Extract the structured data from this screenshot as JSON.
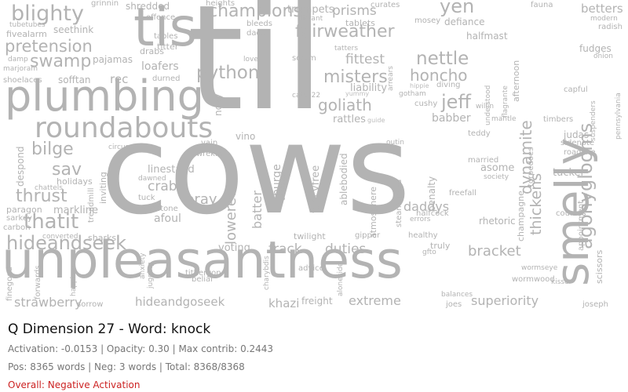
{
  "panel": {
    "title": "Q Dimension 27 - Word: knock",
    "stats_line": "Activation: -0.0153 | Opacity: 0.30 | Max contrib: 0.2443",
    "counts_line": "Pos: 8365 words | Neg: 3 words | Total: 8368/8368",
    "overall": "Overall: Negative Activation"
  },
  "colors": {
    "word_color": "#b3b3b3",
    "title_color": "#111111",
    "stat_color": "#777777",
    "overall_color": "#cc2222"
  },
  "words": [
    "til",
    "cows",
    "unpleasantness",
    "plumbing",
    "tis",
    "smelly",
    "roundabouts",
    "agonyglooms",
    "hideandseek",
    "thatit",
    "blighty",
    "champions",
    "fairweather",
    "pretension",
    "swamp",
    "misters",
    "goliath",
    "python",
    "fittest",
    "nettle",
    "honcho",
    "jeff",
    "dynamite",
    "thickens",
    "bilge",
    "sav",
    "thrust",
    "crabs",
    "bray",
    "lowered",
    "batter",
    "frack",
    "duties",
    "bracket",
    "strawberry",
    "hideandgoseek",
    "extreme",
    "superiority",
    "khazi",
    "freight",
    "daddys",
    "rec",
    "loafers",
    "prisms",
    "yen",
    "trumpets",
    "tablets",
    "betters",
    "halfmast",
    "defiance",
    "fudges",
    "voting",
    "markline",
    "linestand",
    "brimstone",
    "afoul",
    "liability",
    "rattles",
    "babber",
    "judas",
    "roadline",
    "asome",
    "tucker",
    "penalty",
    "fancyfree",
    "ablebodied",
    "atmosphere",
    "steamspeed",
    "rhetoric",
    "courses",
    "appointment",
    "scissors",
    "sarkey",
    "pajamas",
    "seethink",
    "fivealarm",
    "tubetubes",
    "drabs",
    "titter",
    "tables",
    "shredded",
    "grinnin",
    "heights",
    "offence",
    "dads",
    "bleeds",
    "scram",
    "lover",
    "catch22",
    "tatters",
    "curates",
    "distant",
    "arrears",
    "gotham",
    "cushy",
    "willin",
    "teddy",
    "outin",
    "married",
    "society",
    "freefall",
    "halfcock",
    "errors",
    "healthy",
    "gipper",
    "truly",
    "twilight",
    "advice",
    "aloneside",
    "jugging",
    "anxiety",
    "sorrow",
    "joes",
    "joseph",
    "balances",
    "wormwood",
    "kisser",
    "wormseye",
    "sidenote",
    "timbers",
    "mantle",
    "understood",
    "afternoon",
    "radish",
    "modern",
    "onion",
    "capful",
    "suspenders",
    "pennsylvania",
    "champagne",
    "torpedoes",
    "paragon",
    "holidays",
    "chattels",
    "despond",
    "finegood",
    "forwards",
    "happiness",
    "carbon",
    "converted",
    "sharks",
    "inviting",
    "treadmill",
    "circuses",
    "durned",
    "dawned",
    "tuck",
    "vino",
    "vain",
    "wrekin",
    "sofftan",
    "shoelaces",
    "marjoram",
    "damp",
    "nosy",
    "purge",
    "terrors",
    "belial",
    "titheryon",
    "charybdis",
    "gfto",
    "flagrante",
    "fauna",
    "hippie",
    "yummy",
    "diving",
    "guide",
    "mosey"
  ]
}
